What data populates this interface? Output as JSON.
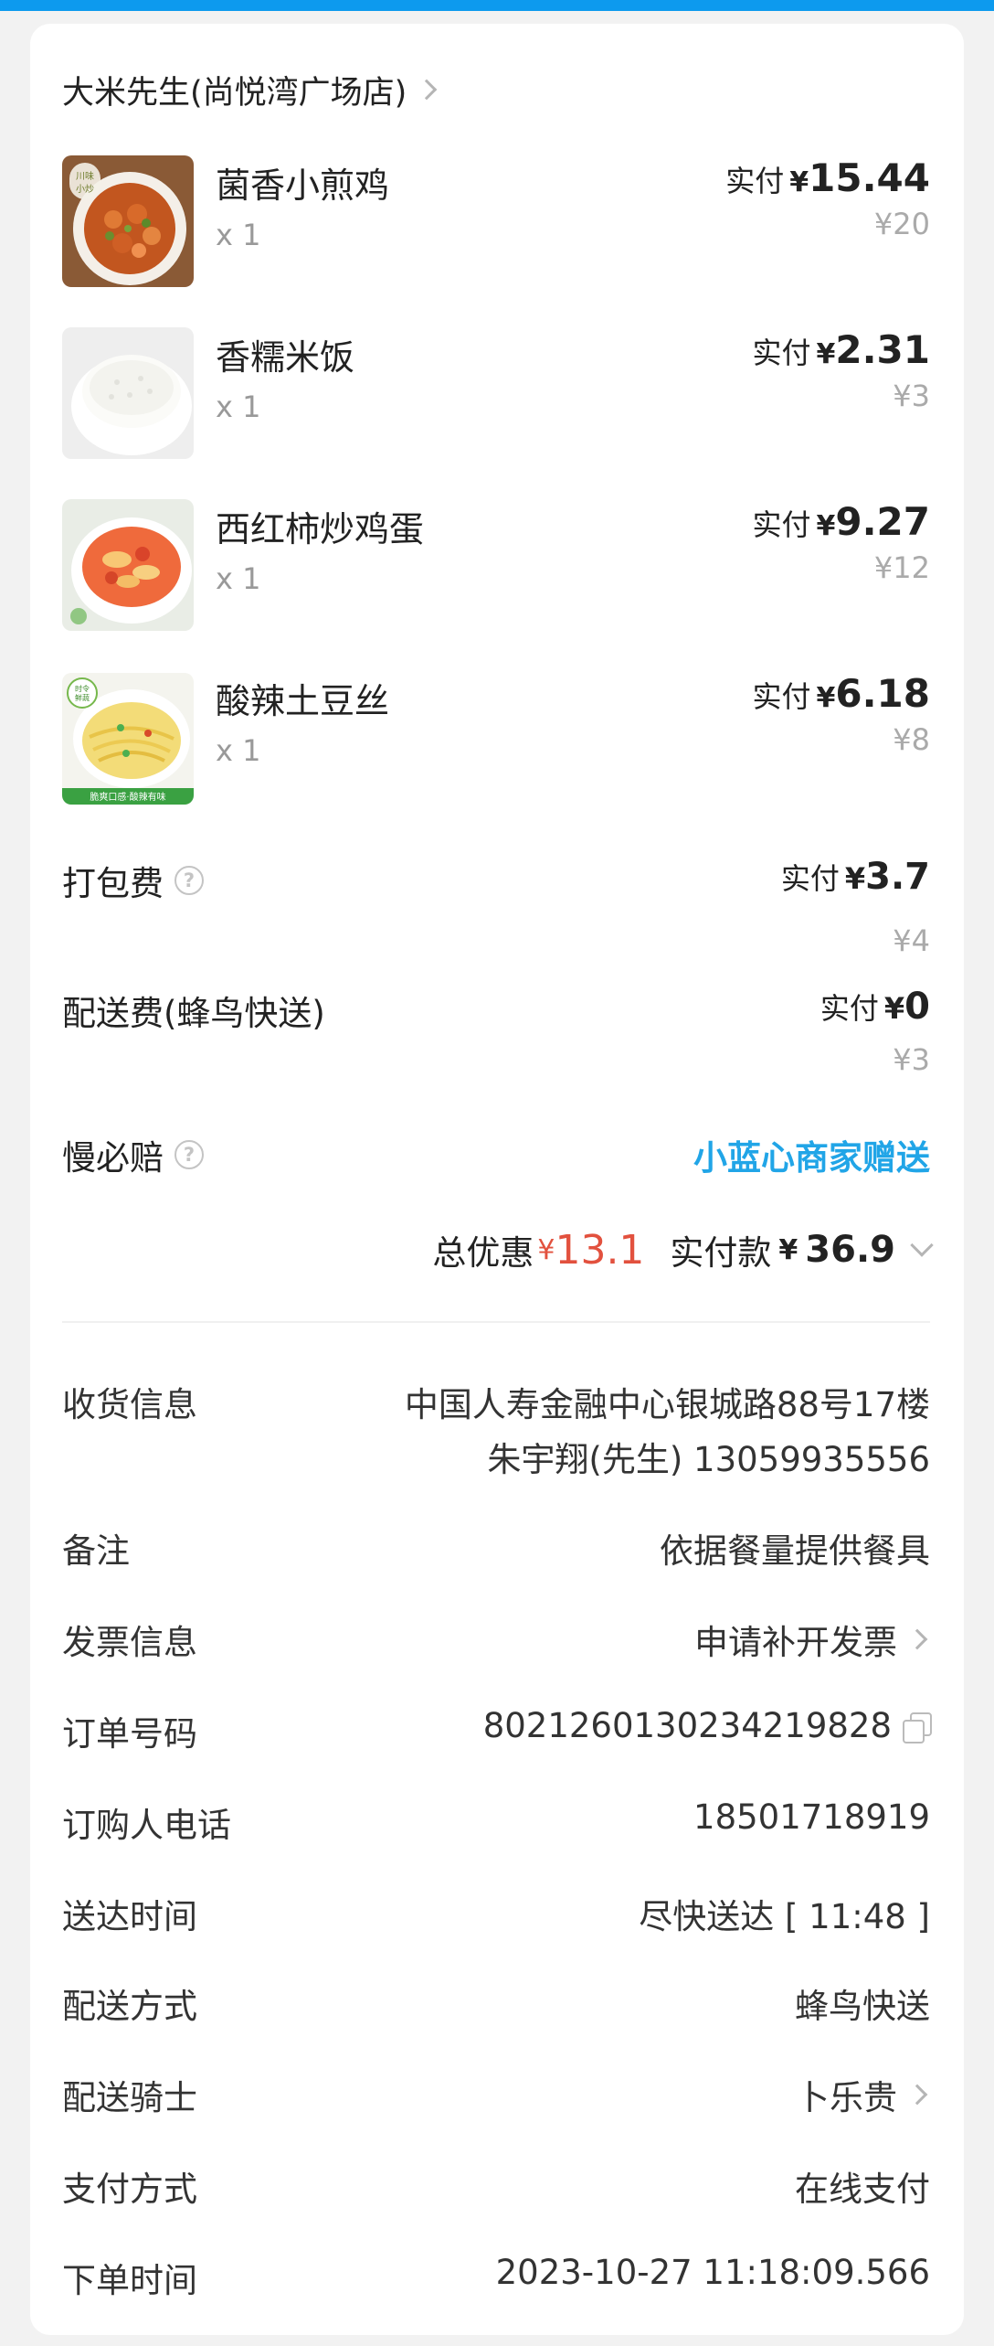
{
  "shop": {
    "name": "大米先生(尚悦湾广场店)"
  },
  "items": [
    {
      "name": "菌香小煎鸡",
      "qty": "x 1",
      "paid_label": "实付",
      "currency": "¥",
      "paid": "15.44",
      "original": "¥20"
    },
    {
      "name": "香糯米饭",
      "qty": "x 1",
      "paid_label": "实付",
      "currency": "¥",
      "paid": "2.31",
      "original": "¥3"
    },
    {
      "name": "西红柿炒鸡蛋",
      "qty": "x 1",
      "paid_label": "实付",
      "currency": "¥",
      "paid": "9.27",
      "original": "¥12"
    },
    {
      "name": "酸辣土豆丝",
      "qty": "x 1",
      "paid_label": "实付",
      "currency": "¥",
      "paid": "6.18",
      "original": "¥8"
    }
  ],
  "fees": {
    "packing": {
      "label": "打包费",
      "paid_label": "实付",
      "currency": "¥",
      "paid": "3.7",
      "original": "¥4"
    },
    "delivery": {
      "label": "配送费(蜂鸟快送)",
      "paid_label": "实付",
      "currency": "¥",
      "paid": "0",
      "original": "¥3"
    },
    "slow": {
      "label": "慢必赔",
      "value": "小蓝心商家赠送"
    }
  },
  "summary": {
    "discount_label": "总优惠",
    "discount_currency": "¥",
    "discount_value": "13.1",
    "paid_label": "实付款",
    "paid_currency": "¥",
    "paid_value": "36.9"
  },
  "info": {
    "address": {
      "label": "收货信息",
      "line1": "中国人寿金融中心银城路88号17楼",
      "line2": "朱宇翔(先生) 13059935556"
    },
    "note": {
      "label": "备注",
      "value": "依据餐量提供餐具"
    },
    "invoice": {
      "label": "发票信息",
      "value": "申请补开发票"
    },
    "order_no": {
      "label": "订单号码",
      "value": "8021260130234219828"
    },
    "phone": {
      "label": "订购人电话",
      "value": "18501718919"
    },
    "delivery_time": {
      "label": "送达时间",
      "value": "尽快送达 [ 11:48 ]"
    },
    "delivery_method": {
      "label": "配送方式",
      "value": "蜂鸟快送"
    },
    "rider": {
      "label": "配送骑士",
      "value": "卜乐贵"
    },
    "payment": {
      "label": "支付方式",
      "value": "在线支付"
    },
    "order_time": {
      "label": "下单时间",
      "value": "2023-10-27 11:18:09.566"
    }
  },
  "colors": {
    "accent_blue": "#21a5e7",
    "discount_red": "#e2513e",
    "topbar": "#0d9aee"
  },
  "thumbnails": [
    {
      "badge": "川味小炒"
    },
    {
      "badge": ""
    },
    {
      "badge": ""
    },
    {
      "badge": "时令鲜蔬",
      "footer": "脆爽口感·酸辣有味"
    }
  ]
}
